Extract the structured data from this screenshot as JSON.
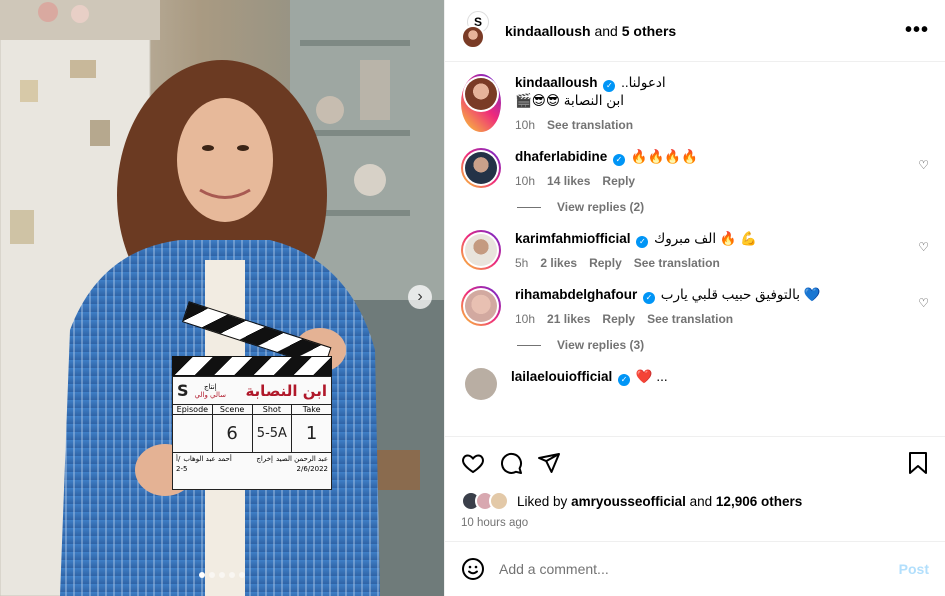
{
  "header": {
    "username": "kindaalloush",
    "joiner": "and",
    "others": "5 others",
    "more_icon": "more-horizontal-icon"
  },
  "comments": [
    {
      "username": "kindaalloush",
      "verified": true,
      "text_line1": "ادعولنا..",
      "text_line2": "ابن النصابة 😎😎🎬",
      "time": "10h",
      "actions": [
        "See translation"
      ],
      "has_like": false
    },
    {
      "username": "dhaferlabidine",
      "verified": true,
      "text": "🔥🔥🔥🔥",
      "time": "10h",
      "likes": "14 likes",
      "actions": [
        "Reply"
      ],
      "has_like": true,
      "view_replies": "View replies (2)"
    },
    {
      "username": "karimfahmiofficial",
      "verified": true,
      "text": "الف مبروك 🔥 💪",
      "time": "5h",
      "likes": "2 likes",
      "actions": [
        "Reply",
        "See translation"
      ],
      "has_like": true
    },
    {
      "username": "rihamabdelghafour",
      "verified": true,
      "text": "بالتوفيق حبيب قلبي يارب 💙",
      "time": "10h",
      "likes": "21 likes",
      "actions": [
        "Reply",
        "See translation"
      ],
      "has_like": true,
      "view_replies": "View replies (3)"
    },
    {
      "username": "lailaelouiofficial",
      "verified": true,
      "text": "❤️ ...",
      "partial": true
    }
  ],
  "actions": {
    "like_icon": "heart-outline-icon",
    "comment_icon": "comment-icon",
    "share_icon": "paper-plane-icon",
    "save_icon": "bookmark-icon"
  },
  "likes": {
    "prefix": "Liked by",
    "user": "amryousseofficial",
    "joiner": "and",
    "count": "12,906 others"
  },
  "time_ago": "10 hours ago",
  "add_comment": {
    "placeholder": "Add a comment...",
    "post_label": "Post",
    "emoji_icon": "emoji-smiley-icon"
  },
  "carousel": {
    "slide_count": 5,
    "active_index": 0,
    "next_icon": "chevron-right-icon"
  },
  "clapperboard": {
    "title": "ابن النصابة",
    "producer_label": "إنتاج",
    "producer": "سالي والي",
    "logo": "S",
    "headers": [
      "Episode",
      "Scene",
      "Shot",
      "Take"
    ],
    "values": [
      "",
      "6",
      "5-5A",
      "1"
    ],
    "director_label": "إخراج",
    "director": "عبد الرحمن الصيد",
    "dop_label": "أ/",
    "dop": "أحمد عبد الوهاب",
    "roll": "2-5",
    "date": "2/6/2022"
  },
  "colors": {
    "verified": "#0095f6",
    "post_disabled": "#b2dffc",
    "muted": "#737373"
  }
}
